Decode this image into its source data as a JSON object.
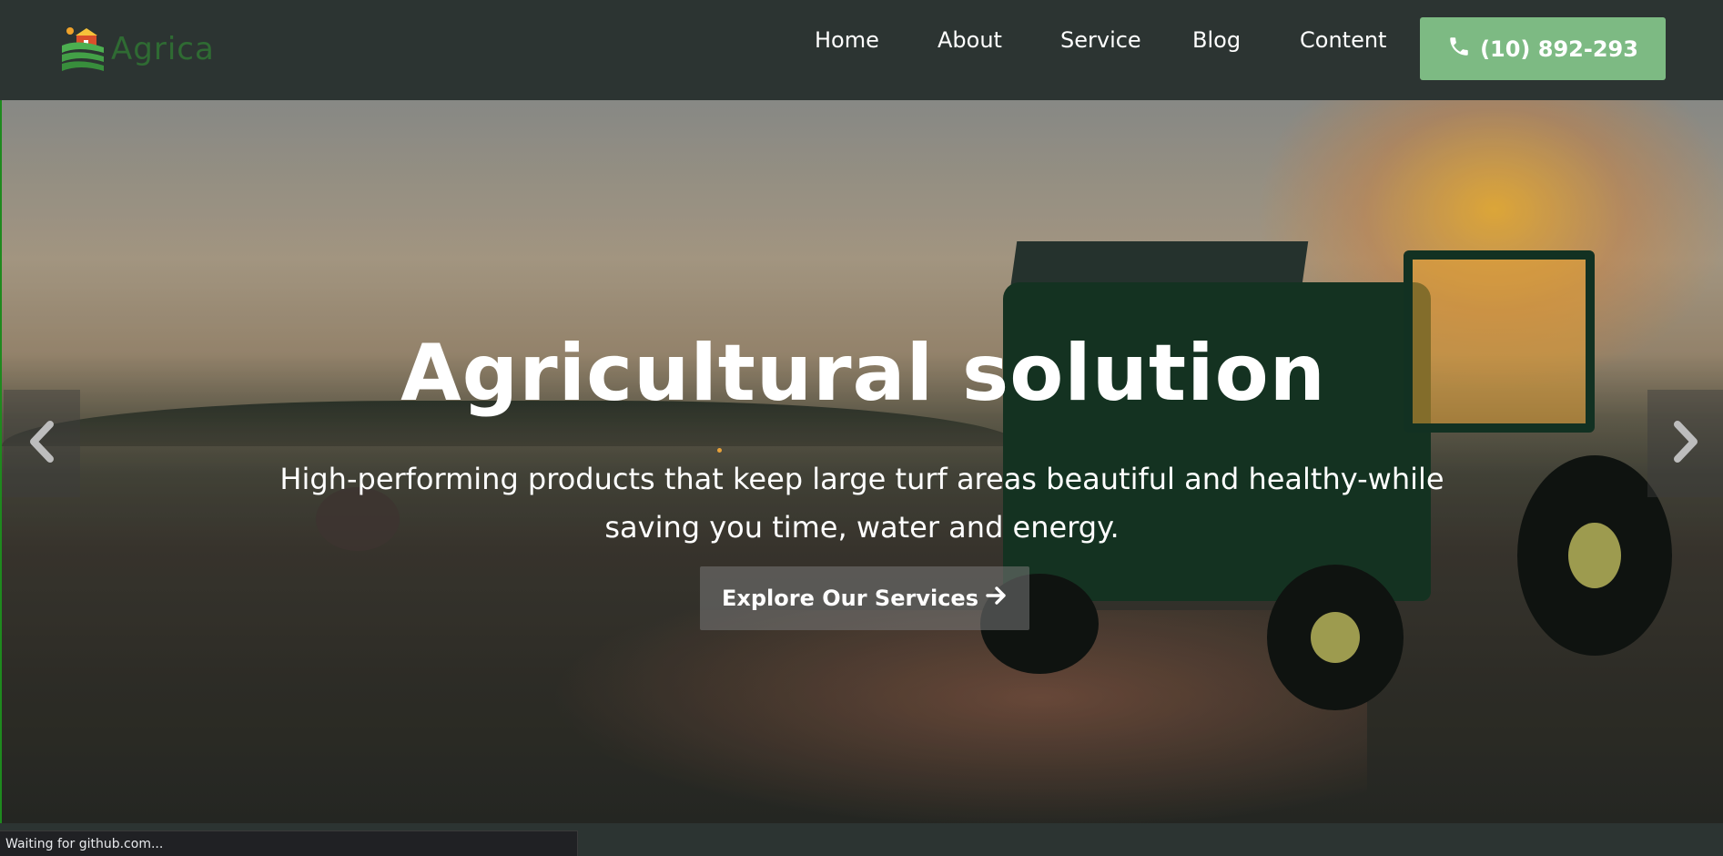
{
  "brand": {
    "name": "Agrica",
    "color": "#2f6b33"
  },
  "nav": {
    "items": [
      {
        "label": "Home"
      },
      {
        "label": "About"
      },
      {
        "label": "Service"
      },
      {
        "label": "Blog"
      },
      {
        "label": "Content"
      }
    ],
    "phone": {
      "label": "(10) 892-293",
      "icon": "phone-icon",
      "color": "#7dba83"
    }
  },
  "hero": {
    "title": "Agricultural solution",
    "subtitle": "High-performing products that keep large turf areas beautiful and healthy-while saving you time, water and energy.",
    "cta_label": "Explore Our Services",
    "cta_icon": "arrow-right-icon",
    "prev_icon": "chevron-left-icon",
    "next_icon": "chevron-right-icon"
  },
  "browser": {
    "status_text": "Waiting for github.com..."
  }
}
